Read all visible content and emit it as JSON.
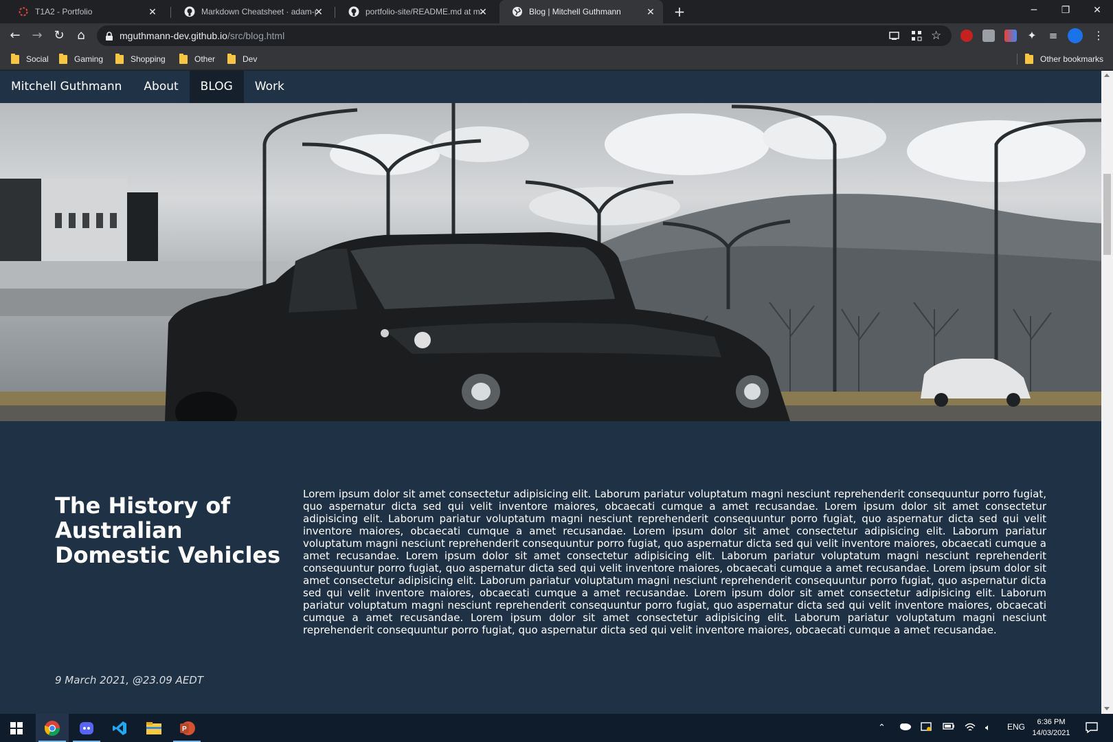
{
  "browser": {
    "tabs": [
      {
        "title": "T1A2 - Portfolio",
        "icon": "loading-ring-icon",
        "active": false
      },
      {
        "title": "Markdown Cheatsheet · adam-p/",
        "icon": "github-icon",
        "active": false
      },
      {
        "title": "portfolio-site/README.md at ma",
        "icon": "github-icon",
        "active": false
      },
      {
        "title": "Blog | Mitchell Guthmann",
        "icon": "globe-icon",
        "active": true
      }
    ],
    "url_host": "mguthmann-dev.github.io",
    "url_path": "/src/blog.html",
    "bookmarks": [
      "Social",
      "Gaming",
      "Shopping",
      "Other",
      "Dev"
    ],
    "other_bookmarks": "Other bookmarks"
  },
  "site": {
    "nav": {
      "brand": "Mitchell Guthmann",
      "about": "About",
      "blog": "BLOG",
      "work": "Work"
    },
    "hero_alt": "Black Holden ute in front of street lamps and hills",
    "post": {
      "title": "The History of Australian Domestic Vehicles",
      "body": "Lorem ipsum dolor sit amet consectetur adipisicing elit. Laborum pariatur voluptatum magni nesciunt reprehenderit consequuntur porro fugiat, quo aspernatur dicta sed qui velit inventore maiores, obcaecati cumque a amet recusandae. Lorem ipsum dolor sit amet consectetur adipisicing elit. Laborum pariatur voluptatum magni nesciunt reprehenderit consequuntur porro fugiat, quo aspernatur dicta sed qui velit inventore maiores, obcaecati cumque a amet recusandae. Lorem ipsum dolor sit amet consectetur adipisicing elit. Laborum pariatur voluptatum magni nesciunt reprehenderit consequuntur porro fugiat, quo aspernatur dicta sed qui velit inventore maiores, obcaecati cumque a amet recusandae. Lorem ipsum dolor sit amet consectetur adipisicing elit. Laborum pariatur voluptatum magni nesciunt reprehenderit consequuntur porro fugiat, quo aspernatur dicta sed qui velit inventore maiores, obcaecati cumque a amet recusandae. Lorem ipsum dolor sit amet consectetur adipisicing elit. Laborum pariatur voluptatum magni nesciunt reprehenderit consequuntur porro fugiat, quo aspernatur dicta sed qui velit inventore maiores, obcaecati cumque a amet recusandae. Lorem ipsum dolor sit amet consectetur adipisicing elit. Laborum pariatur voluptatum magni nesciunt reprehenderit consequuntur porro fugiat, quo aspernatur dicta sed qui velit inventore maiores, obcaecati cumque a amet recusandae. Lorem ipsum dolor sit amet consectetur adipisicing elit. Laborum pariatur voluptatum magni nesciunt reprehenderit consequuntur porro fugiat, quo aspernatur dicta sed qui velit inventore maiores, obcaecati cumque a amet recusandae.",
      "date": "9 March 2021, @23.09 AEDT"
    }
  },
  "taskbar": {
    "apps": [
      "chrome-icon",
      "discord-icon",
      "vscode-icon",
      "file-explorer-icon",
      "powerpoint-icon"
    ],
    "language": "ENG",
    "time": "6:36 PM",
    "date": "14/03/2021"
  },
  "colors": {
    "page_bg": "#1f3144",
    "nav_bg": "#203246",
    "nav_active": "#15202c",
    "chrome_dark": "#202124",
    "chrome_toolbar": "#35363a"
  }
}
